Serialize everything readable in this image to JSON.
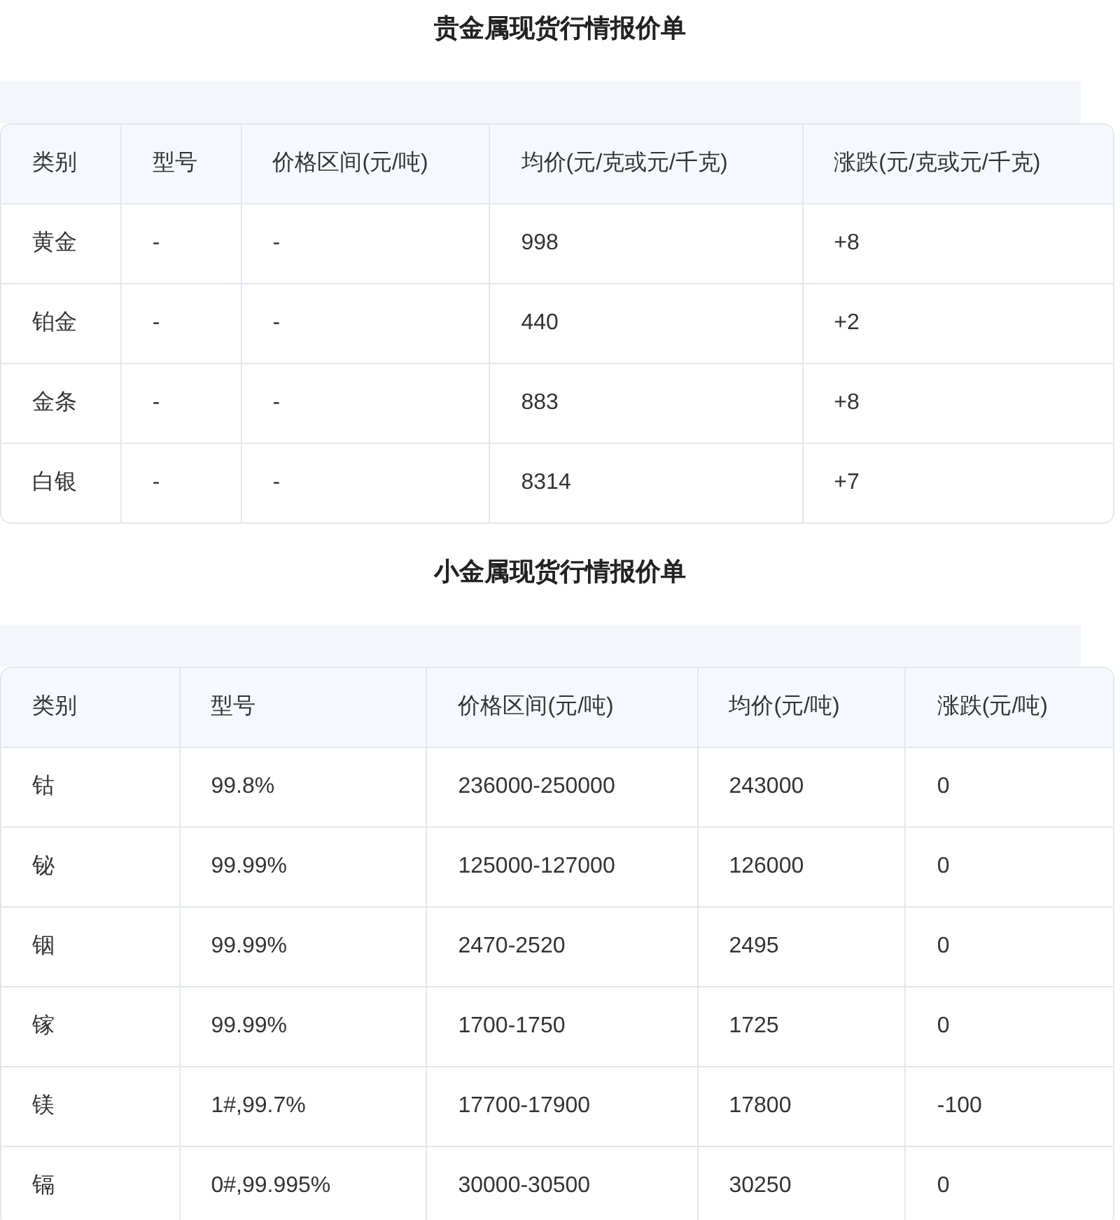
{
  "sections": [
    {
      "title": "贵金属现货行情报价单",
      "columns": [
        "类别",
        "型号",
        "价格区间(元/吨)",
        "均价(元/克或元/千克)",
        "涨跌(元/克或元/千克)"
      ],
      "rows": [
        [
          "黄金",
          "-",
          "-",
          "998",
          "+8"
        ],
        [
          "铂金",
          "-",
          "-",
          "440",
          "+2"
        ],
        [
          "金条",
          "-",
          "-",
          "883",
          "+8"
        ],
        [
          "白银",
          "-",
          "-",
          "8314",
          "+7"
        ]
      ]
    },
    {
      "title": "小金属现货行情报价单",
      "columns": [
        "类别",
        "型号",
        "价格区间(元/吨)",
        "均价(元/吨)",
        "涨跌(元/吨)"
      ],
      "rows": [
        [
          "钴",
          "99.8%",
          "236000-250000",
          "243000",
          "0"
        ],
        [
          "铋",
          "99.99%",
          "125000-127000",
          "126000",
          "0"
        ],
        [
          "铟",
          "99.99%",
          "2470-2520",
          "2495",
          "0"
        ],
        [
          "镓",
          "99.99%",
          "1700-1750",
          "1725",
          "0"
        ],
        [
          "镁",
          "1#,99.7%",
          "17700-17900",
          "17800",
          "-100"
        ],
        [
          "镉",
          "0#,99.995%",
          "30000-30500",
          "30250",
          "0"
        ]
      ]
    }
  ]
}
